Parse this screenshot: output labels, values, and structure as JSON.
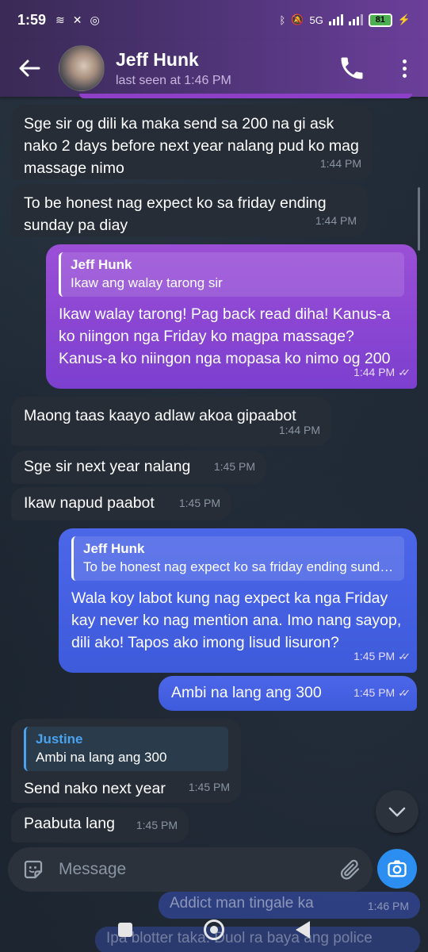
{
  "status_bar": {
    "time": "1:59",
    "network": "5G",
    "battery": "81"
  },
  "header": {
    "contact_name": "Jeff Hunk",
    "last_seen": "last seen at 1:46 PM"
  },
  "messages": [
    {
      "text": "Sge sir og dili ka maka send sa 200 na gi ask nako 2 days before next year nalang pud ko mag massage nimo",
      "time": "1:44 PM"
    },
    {
      "text": "To be honest nag expect ko sa friday ending sunday pa diay",
      "time": "1:44 PM"
    },
    {
      "quote_name": "Jeff Hunk",
      "quote_text": "Ikaw ang walay tarong sir",
      "text": "Ikaw walay tarong! Pag back read diha! Kanus-a ko niingon nga Friday ko magpa massage? Kanus-a ko niingon nga mopasa ko nimo og 200",
      "time": "1:44 PM"
    },
    {
      "text": "Maong taas kaayo adlaw akoa gipaabot",
      "time": "1:44 PM"
    },
    {
      "text": "Sge sir next year nalang",
      "time": "1:45 PM"
    },
    {
      "text": "Ikaw napud paabot",
      "time": "1:45 PM"
    },
    {
      "quote_name": "Jeff Hunk",
      "quote_text": "To be honest nag expect ko sa friday ending sunday pa diay",
      "text": "Wala koy labot kung nag expect ka nga Friday kay never ko nag mention ana. Imo nang sayop, dili ako! Tapos ako imong lisud lisuron?",
      "time": "1:45 PM"
    },
    {
      "text": "Ambi na lang ang 300",
      "time": "1:45 PM"
    },
    {
      "quote_name": "Justine",
      "quote_text": "Ambi na lang ang 300",
      "text": "Send nako next year",
      "time": "1:45 PM"
    },
    {
      "text": "Paabuta lang",
      "time": "1:45 PM"
    }
  ],
  "input": {
    "placeholder": "Message"
  },
  "faded": [
    {
      "text": "Addict man tingale ka",
      "time": "1:46 PM"
    },
    {
      "text": "Ipa blotter taka. Duol ra baya ang police"
    }
  ],
  "colors": {
    "header": "#4a3270",
    "incoming_bubble": "#262d36",
    "outgoing_purple": "#8a45d3",
    "outgoing_blue": "#4560e2",
    "accent": "#2b8ef0"
  }
}
